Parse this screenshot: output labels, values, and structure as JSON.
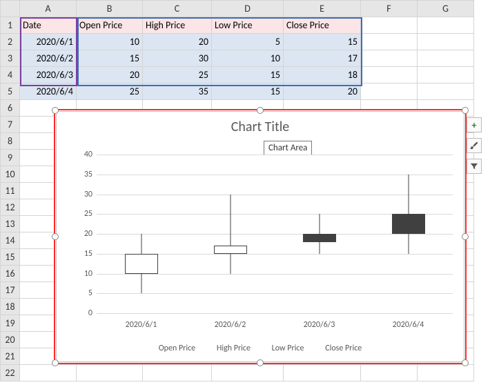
{
  "columns": [
    "A",
    "B",
    "C",
    "D",
    "E",
    "F",
    "G"
  ],
  "row_numbers": [
    1,
    2,
    3,
    4,
    5,
    6,
    7,
    8,
    9,
    10,
    11,
    12,
    13,
    14,
    15,
    16,
    17,
    18,
    19,
    20,
    21,
    22
  ],
  "table": {
    "headers": [
      "Date",
      "Open Price",
      "High Price",
      "Low Price",
      "Close Price"
    ],
    "rows": [
      {
        "date": "2020/6/1",
        "open": 10,
        "high": 20,
        "low": 5,
        "close": 15
      },
      {
        "date": "2020/6/2",
        "open": 15,
        "high": 30,
        "low": 10,
        "close": 17
      },
      {
        "date": "2020/6/3",
        "open": 20,
        "high": 25,
        "low": 15,
        "close": 18
      },
      {
        "date": "2020/6/4",
        "open": 25,
        "high": 35,
        "low": 15,
        "close": 20
      }
    ]
  },
  "chart": {
    "title": "Chart Title",
    "tooltip": "Chart Area",
    "legend": [
      "Open Price",
      "High Price",
      "Low Price",
      "Close Price"
    ],
    "side_buttons": {
      "plus": "+",
      "brush": "brush-icon",
      "filter": "filter-icon"
    }
  },
  "chart_data": {
    "type": "candlestick",
    "title": "Chart Title",
    "xlabel": "",
    "ylabel": "",
    "ylim": [
      0,
      40
    ],
    "yticks": [
      0,
      5,
      10,
      15,
      20,
      25,
      30,
      35,
      40
    ],
    "categories": [
      "2020/6/1",
      "2020/6/2",
      "2020/6/3",
      "2020/6/4"
    ],
    "series_names": [
      "Open Price",
      "High Price",
      "Low Price",
      "Close Price"
    ],
    "ohlc": [
      {
        "open": 10,
        "high": 20,
        "low": 5,
        "close": 15
      },
      {
        "open": 15,
        "high": 30,
        "low": 10,
        "close": 17
      },
      {
        "open": 20,
        "high": 25,
        "low": 15,
        "close": 18
      },
      {
        "open": 25,
        "high": 35,
        "low": 15,
        "close": 20
      }
    ]
  }
}
